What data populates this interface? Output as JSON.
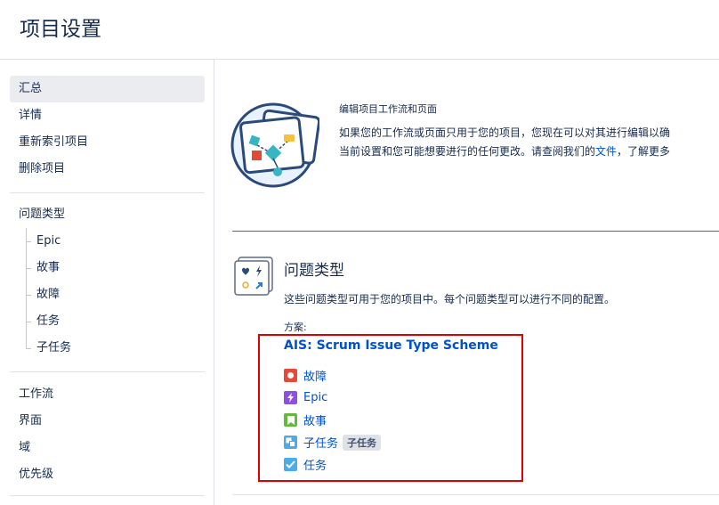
{
  "header": {
    "title": "项目设置"
  },
  "sidebar": {
    "group1": [
      {
        "label": "汇总",
        "active": true
      },
      {
        "label": "详情"
      },
      {
        "label": "重新索引项目"
      },
      {
        "label": "删除项目"
      }
    ],
    "issue_types": {
      "label": "问题类型",
      "items": [
        "Epic",
        "故事",
        "故障",
        "任务",
        "子任务"
      ]
    },
    "group3": [
      {
        "label": "工作流"
      },
      {
        "label": "界面"
      },
      {
        "label": "域"
      },
      {
        "label": "优先级"
      }
    ]
  },
  "workflow_panel": {
    "title": "编辑项目工作流和页面",
    "line1": "如果您的工作流或页面只用于您的项目，您现在可以对其进行编辑以确",
    "line2_before": "当前设置和您可能想要进行的任何更改。请查阅我们的",
    "line2_link": "文件",
    "line2_after": "，了解更多"
  },
  "issue_types_section": {
    "title": "问题类型",
    "description": "这些问题类型可用于您的项目中。每个问题类型可以进行不同的配置。",
    "scheme_label": "方案:",
    "scheme_name": "AIS: Scrum Issue Type Scheme",
    "types": [
      {
        "label": "故障",
        "icon": "bug-icon",
        "color": "#e5493a"
      },
      {
        "label": "Epic",
        "icon": "epic-lightning-icon",
        "color": "#904ee2"
      },
      {
        "label": "故事",
        "icon": "story-bookmark-icon",
        "color": "#63ba3c"
      },
      {
        "label": "子任务",
        "icon": "subtask-icon",
        "color": "#4bade8",
        "badge": "子任务"
      },
      {
        "label": "任务",
        "icon": "task-check-icon",
        "color": "#4bade8"
      }
    ]
  },
  "colors": {
    "link": "#0052cc",
    "highlight": "#e00000",
    "text": "#172b4d"
  }
}
